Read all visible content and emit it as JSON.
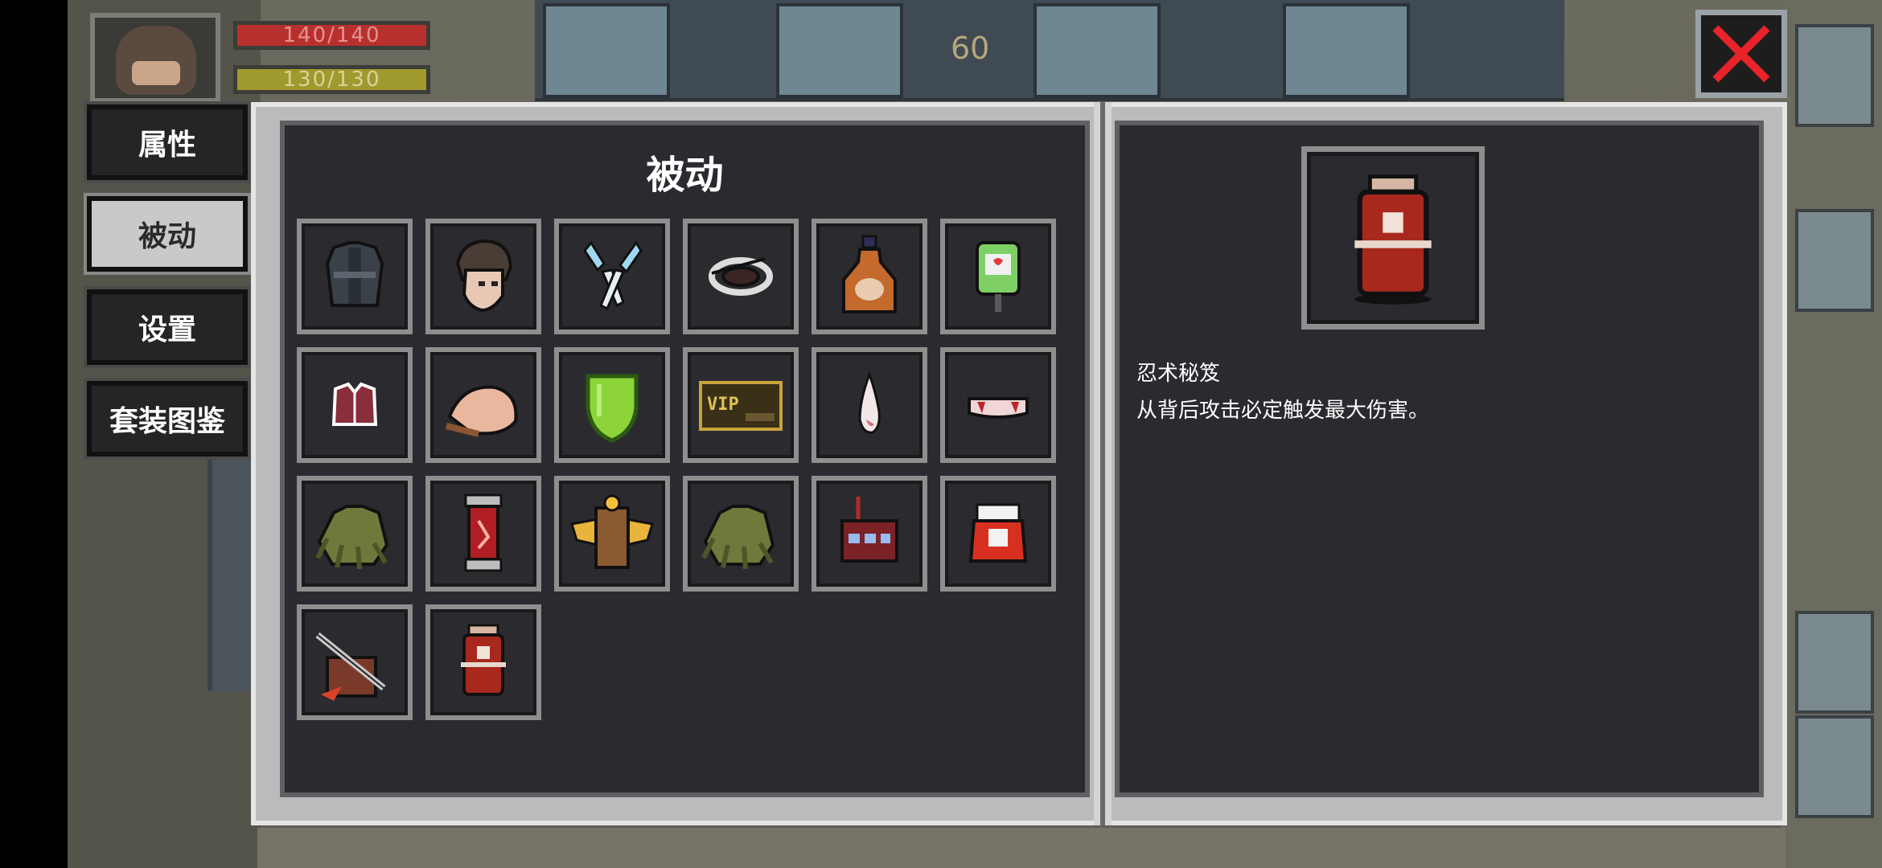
{
  "hud": {
    "hp_text": "140/140",
    "mp_text": "130/130",
    "level": "60"
  },
  "tabs": [
    {
      "label": "属性",
      "active": false
    },
    {
      "label": "被动",
      "active": true
    },
    {
      "label": "设置",
      "active": false
    },
    {
      "label": "套装图鉴",
      "active": false
    }
  ],
  "section_title": "被动",
  "items": [
    {
      "icon": "armor-vest-icon"
    },
    {
      "icon": "character-head-icon"
    },
    {
      "icon": "scissors-icon"
    },
    {
      "icon": "cable-coil-icon"
    },
    {
      "icon": "potion-bottle-icon"
    },
    {
      "icon": "iv-bag-icon"
    },
    {
      "icon": "vest-top-icon"
    },
    {
      "icon": "roast-meat-icon"
    },
    {
      "icon": "green-shield-icon"
    },
    {
      "icon": "vip-card-icon"
    },
    {
      "icon": "fang-tooth-icon"
    },
    {
      "icon": "vampire-teeth-icon"
    },
    {
      "icon": "claw-hand-icon"
    },
    {
      "icon": "red-capsule-icon"
    },
    {
      "icon": "winged-chest-icon"
    },
    {
      "icon": "claw-hand-icon"
    },
    {
      "icon": "radio-device-icon"
    },
    {
      "icon": "red-jar-icon"
    },
    {
      "icon": "sword-crate-icon"
    },
    {
      "icon": "ninja-scroll-icon"
    }
  ],
  "selected_item": {
    "icon": "ninja-scroll-icon",
    "name": "忍术秘笈",
    "description": "从背后攻击必定触发最大伤害。"
  },
  "colors": {
    "panel_bg": "#2a2a30",
    "slot_border": "#8e8e8e",
    "hp": "#b8302e",
    "mp": "#a09a2e",
    "close_x": "#e8242a"
  }
}
